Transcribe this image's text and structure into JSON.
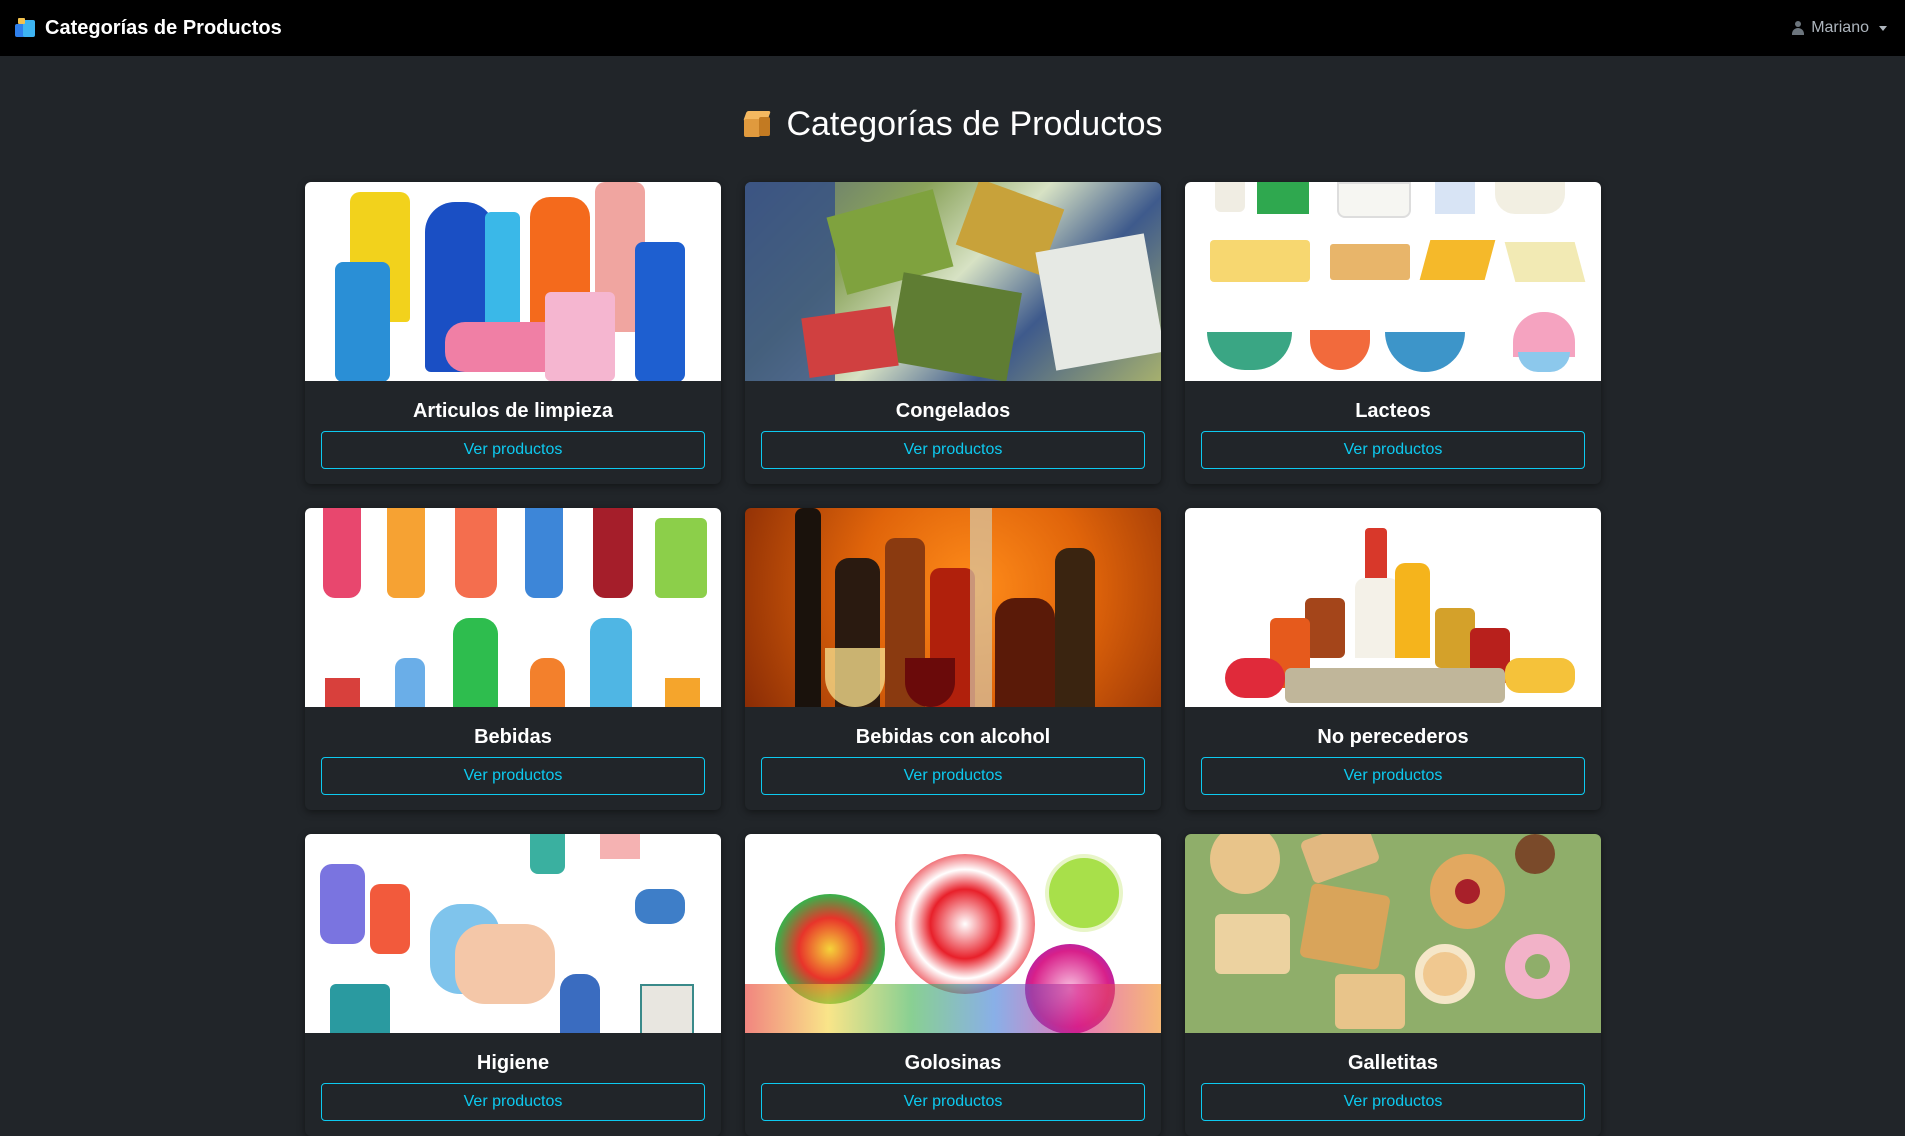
{
  "navbar": {
    "brand_label": "Categorías de Productos",
    "brand_icon": "boxes-icon",
    "user_name": "Mariano",
    "user_icon": "user-icon"
  },
  "page": {
    "title": "Categorías de Productos",
    "title_icon": "package-icon"
  },
  "categories": [
    {
      "name": "Articulos de limpieza",
      "button": "Ver productos",
      "image": "cleaning-products-photo"
    },
    {
      "name": "Congelados",
      "button": "Ver productos",
      "image": "frozen-food-photo"
    },
    {
      "name": "Lacteos",
      "button": "Ver productos",
      "image": "dairy-illustration"
    },
    {
      "name": "Bebidas",
      "button": "Ver productos",
      "image": "drinks-illustration"
    },
    {
      "name": "Bebidas con alcohol",
      "button": "Ver productos",
      "image": "alcohol-bottles-photo"
    },
    {
      "name": "No perecederos",
      "button": "Ver productos",
      "image": "canned-goods-photo"
    },
    {
      "name": "Higiene",
      "button": "Ver productos",
      "image": "hygiene-illustration"
    },
    {
      "name": "Golosinas",
      "button": "Ver productos",
      "image": "candy-photo"
    },
    {
      "name": "Galletitas",
      "button": "Ver productos",
      "image": "cookies-photo"
    }
  ],
  "colors": {
    "background": "#212529",
    "navbar": "#000000",
    "accent": "#0dcaf0"
  }
}
